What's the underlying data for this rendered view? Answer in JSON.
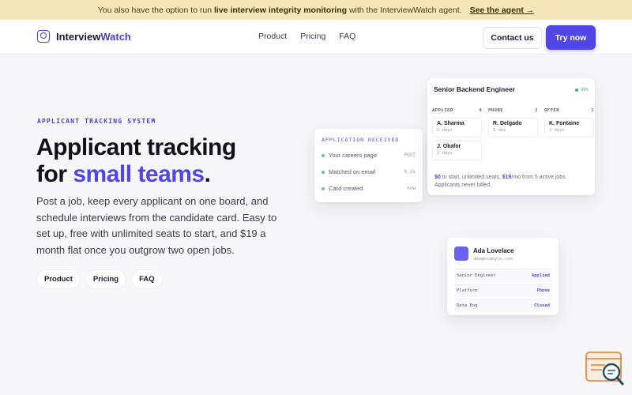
{
  "banner": {
    "text_before": "You also have the option to run",
    "text_bold": "live interview integrity monitoring",
    "text_after": "with the InterviewWatch agent.",
    "link": "See the agent →"
  },
  "nav": {
    "logo_part1": "Interview",
    "logo_part2": "Watch",
    "links": [
      "Product",
      "Pricing",
      "FAQ"
    ],
    "contact_label": "Contact us",
    "try_label": "Try now"
  },
  "hero": {
    "eyebrow": "APPLICANT TRACKING SYSTEM",
    "title_line1": "Applicant tracking",
    "title_for": "for",
    "title_accent": "small teams",
    "title_period": ".",
    "description": "Post a job, keep every applicant on one board, and schedule interviews from the candidate card. Easy to set up, free with unlimited seats to start, and $19 a month flat once you outgrow two open jobs.",
    "pills": [
      "Product",
      "Pricing",
      "FAQ"
    ]
  },
  "application_card": {
    "header": "APPLICATION RECEIVED",
    "rows": [
      {
        "label": "Your careers page",
        "meta": "POST",
        "color": "#7ab8a0"
      },
      {
        "label": "Matched on email",
        "meta": "0.2s",
        "color": "#7ab8a0"
      },
      {
        "label": "Card created",
        "meta": "now",
        "color": "#7ab8a0"
      }
    ]
  },
  "board": {
    "title": "Senior Backend Engineer",
    "live": "90%",
    "columns": [
      {
        "name": "APPLIED",
        "count": "4",
        "tiles": [
          {
            "name": "A. Sharma",
            "days": "2 days"
          },
          {
            "name": "J. Okafor",
            "days": "2 days"
          }
        ]
      },
      {
        "name": "PHONE",
        "count": "2",
        "tiles": [
          {
            "name": "R. Delgado",
            "days": "1 day"
          }
        ]
      },
      {
        "name": "OFFER",
        "count": "1",
        "tiles": [
          {
            "name": "K. Fontaine",
            "days": "2 days"
          }
        ]
      }
    ],
    "price_a": "$0",
    "price_b": "to start, unlimited seats.",
    "price_c": "$19",
    "price_d": "/mo from 5 active jobs",
    "price_e": "Applicants never billed."
  },
  "profile": {
    "name": "Ada Lovelace",
    "email": "ada@example.com",
    "rows": [
      {
        "role": "Senior Engineer",
        "status": "Applied"
      },
      {
        "role": "Platform",
        "status": "Phone"
      },
      {
        "role": "Data Eng",
        "status": "Closed"
      }
    ]
  },
  "colors": {
    "accent": "#4f46e5",
    "banner": "#f6e7b8"
  }
}
